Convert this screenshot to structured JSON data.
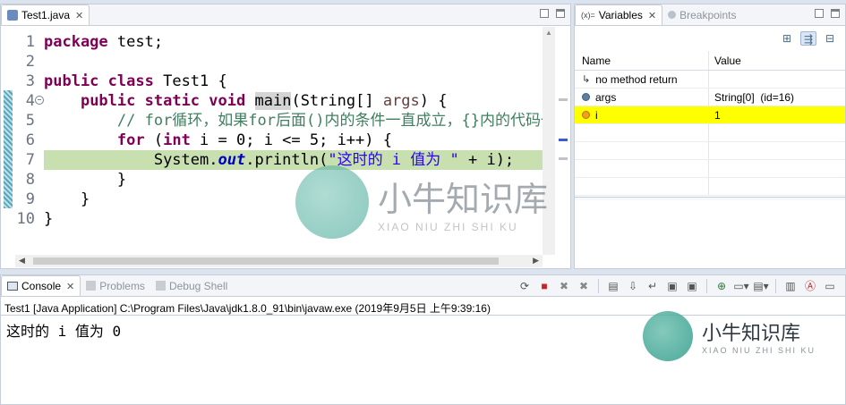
{
  "editor": {
    "tab_title": "Test1.java",
    "close_glyph": "✕",
    "line_numbers": [
      "1",
      "2",
      "3",
      "4",
      "5",
      "6",
      "7",
      "8",
      "9",
      "10"
    ],
    "code": {
      "l1_kw": "package",
      "l1_rest": " test;",
      "l3_kw1": "public",
      "l3_kw2": "class",
      "l3_rest": " Test1 {",
      "l4_kw1": "public",
      "l4_kw2": "static",
      "l4_kw3": "void",
      "l4_method": "main",
      "l4_open": "(String[] ",
      "l4_param": "args",
      "l4_close": ") {",
      "l5_comment": "// for循环，如果for后面()内的条件一直成立，{}内的代码一直执",
      "l6_kw1": "for",
      "l6_open": " (",
      "l6_kw2": "int",
      "l6_rest": " i = 0; i <= 5; i++) {",
      "l7_pre": "System.",
      "l7_field": "out",
      "l7_mid": ".println(",
      "l7_str": "\"这时的 i 值为 \"",
      "l7_rest": " + i);",
      "l8": "}",
      "l9": "}",
      "l10": "}"
    }
  },
  "variables": {
    "tab_label": "Variables",
    "tab_prefix": "(x)=",
    "breakpoints_label": "Breakpoints",
    "col_name": "Name",
    "col_value": "Value",
    "rows": [
      {
        "name": "no method return",
        "value": ""
      },
      {
        "name": "args",
        "value": "String[0]  (id=16)"
      },
      {
        "name": "i",
        "value": "1"
      }
    ]
  },
  "console": {
    "tabs": [
      "Console",
      "Problems",
      "Debug Shell"
    ],
    "process_line": "Test1 [Java Application] C:\\Program Files\\Java\\jdk1.8.0_91\\bin\\javaw.exe (2019年9月5日 上午9:39:16)",
    "output": "这时的 i 值为 0"
  },
  "watermark": {
    "cn": "小牛知识库",
    "pinyin": "XIAO NIU ZHI SHI KU"
  },
  "colors": {
    "current_line": "#c8dfb0",
    "selected_variable": "#ffff00",
    "keyword": "#7f0055",
    "comment": "#3f7f5f",
    "string": "#2a00ff"
  }
}
